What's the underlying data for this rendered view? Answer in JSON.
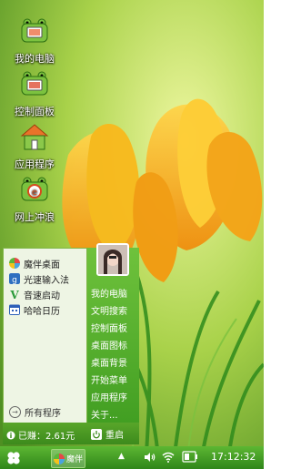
{
  "desktop": {
    "icons": [
      {
        "label": "我的电脑",
        "icon": "frog-monitor-icon"
      },
      {
        "label": "控制面板",
        "icon": "frog-control-panel-icon"
      },
      {
        "label": "应用程序",
        "icon": "frog-house-icon"
      },
      {
        "label": "网上冲浪",
        "icon": "frog-browser-icon"
      }
    ]
  },
  "start_menu": {
    "apps": [
      {
        "label": "魔伴桌面",
        "icon": "pinwheel-icon",
        "color": "#4aa3df"
      },
      {
        "label": "光速输入法",
        "icon": "input-method-icon",
        "color": "#2e6fc0"
      },
      {
        "label": "音速启动",
        "icon": "launcher-icon",
        "color": "#2b9a3a"
      },
      {
        "label": "哈哈日历",
        "icon": "calendar-icon",
        "color": "#2d5fb8"
      }
    ],
    "all_programs": "所有程序",
    "earned": "已赚：2.61元",
    "restart": "重启",
    "menu_items": [
      "我的电脑",
      "文明搜索",
      "控制面板",
      "桌面图标",
      "桌面背景",
      "开始菜单",
      "应用程序",
      "关于..."
    ]
  },
  "taskbar": {
    "task_label": "魔伴",
    "clock": "17:12:32",
    "tray_up": "▲"
  },
  "colors": {
    "accent": "#4caf2a",
    "menu_bg": "#eef5e4"
  }
}
